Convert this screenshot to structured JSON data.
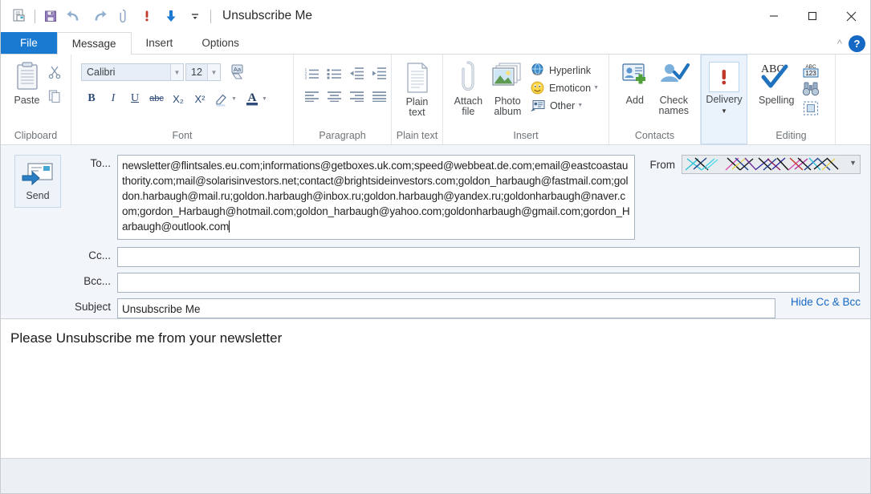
{
  "window": {
    "title": "Unsubscribe Me",
    "minimize_label": "Minimize",
    "maximize_label": "Maximize",
    "close_label": "Close",
    "help_label": "?",
    "collapse_ribbon_label": "Collapse Ribbon"
  },
  "quick_access": [
    {
      "name": "new-message-icon",
      "label": "New message"
    },
    {
      "name": "save-icon",
      "label": "Save"
    },
    {
      "name": "undo-icon",
      "label": "Undo"
    },
    {
      "name": "redo-icon",
      "label": "Redo"
    },
    {
      "name": "attach-icon",
      "label": "Attach"
    },
    {
      "name": "priority-icon",
      "label": "High priority"
    },
    {
      "name": "download-icon",
      "label": "Download"
    },
    {
      "name": "qat-dropdown-icon",
      "label": "Customize Quick Access Toolbar"
    }
  ],
  "tabs": [
    {
      "label": "File",
      "kind": "file"
    },
    {
      "label": "Message",
      "kind": "active"
    },
    {
      "label": "Insert",
      "kind": "normal"
    },
    {
      "label": "Options",
      "kind": "normal"
    }
  ],
  "ribbon": {
    "clipboard": {
      "group_label": "Clipboard",
      "paste_label": "Paste",
      "cut_label": "Cut",
      "copy_label": "Copy"
    },
    "font": {
      "group_label": "Font",
      "font_name": "Calibri",
      "font_size": "12",
      "clear_formatting_label": "Clear formatting",
      "bold": "B",
      "italic": "I",
      "underline": "U",
      "strikethrough": "abc",
      "subscript": "X₂",
      "superscript": "X²",
      "highlight_label": "Text highlight color",
      "fontcolor": "A"
    },
    "paragraph": {
      "group_label": "Paragraph",
      "numbered_list_label": "Numbered list",
      "bulleted_list_label": "Bulleted list",
      "decrease_indent_label": "Decrease indent",
      "increase_indent_label": "Increase indent",
      "align_left_label": "Align left",
      "align_center_label": "Center",
      "align_right_label": "Align right",
      "justify_label": "Justify"
    },
    "plaintext": {
      "group_label": "Plain text",
      "button_label_line1": "Plain",
      "button_label_line2": "text"
    },
    "insert": {
      "group_label": "Insert",
      "attach_file_line1": "Attach",
      "attach_file_line2": "file",
      "photo_album_line1": "Photo",
      "photo_album_line2": "album",
      "hyperlink_label": "Hyperlink",
      "emoticon_label": "Emoticon",
      "other_label": "Other"
    },
    "contacts": {
      "group_label": "Contacts",
      "add_label": "Add",
      "check_names_line1": "Check",
      "check_names_line2": "names"
    },
    "delivery": {
      "group_label": "",
      "label": "Delivery"
    },
    "editing": {
      "group_label": "Editing",
      "spelling_label": "Spelling",
      "abc123_label": "Word count",
      "find_label": "Find",
      "select_label": "Select"
    }
  },
  "compose": {
    "send_label": "Send",
    "to_label": "To...",
    "to_value": "newsletter@flintsales.eu.com;informations@getboxes.uk.com;speed@webbeat.de.com;email@eastcoastauthority.com;mail@solarisinvestors.net;contact@brightsideinvestors.com;goldon_harbaugh@fastmail.com;goldon.harbaugh@mail.ru;goldon.harbaugh@inbox.ru;goldon.harbaugh@yandex.ru;goldonharbaugh@naver.com;gordon_Harbaugh@hotmail.com;goldon_harbaugh@yahoo.com;goldonharbaugh@gmail.com;gordon_Harbaugh@outlook.com",
    "cc_label": "Cc...",
    "cc_value": "",
    "bcc_label": "Bcc...",
    "bcc_value": "",
    "subject_label": "Subject",
    "subject_value": "Unsubscribe Me",
    "from_label": "From",
    "from_value": "",
    "from_redacted": true,
    "hide_cc_bcc_label": "Hide Cc & Bcc",
    "body_text": "Please Unsubscribe me from your newsletter"
  },
  "colors": {
    "accent_blue": "#1a7ad1",
    "file_tab": "#1a7ad1",
    "link_blue": "#1568c4",
    "header_bg": "#f2f5f9",
    "ribbon_icon_blue": "#2f4c7a",
    "priority_red": "#c0392b"
  }
}
